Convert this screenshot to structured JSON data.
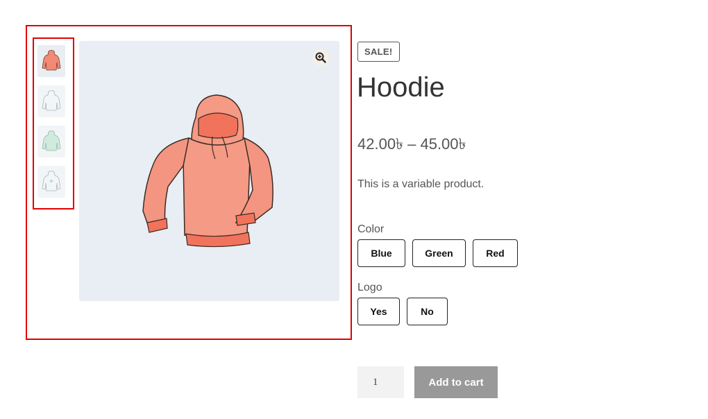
{
  "gallery": {
    "thumbnails": [
      {
        "name": "hoodie-pink",
        "color": "#f08a74"
      },
      {
        "name": "hoodie-white",
        "color": "#d7e6e8"
      },
      {
        "name": "hoodie-green",
        "color": "#a8dcc4"
      },
      {
        "name": "hoodie-white-logo",
        "color": "#d7e6e8"
      }
    ],
    "main_image_color": "#f0907a",
    "zoom_icon": "zoom-in-icon"
  },
  "product": {
    "badge": "SALE!",
    "title": "Hoodie",
    "price": "42.00৳ – 45.00৳",
    "description": "This is a variable product."
  },
  "attributes": {
    "color_label": "Color",
    "color_options": [
      "Blue",
      "Green",
      "Red"
    ],
    "logo_label": "Logo",
    "logo_options": [
      "Yes",
      "No"
    ]
  },
  "cart": {
    "quantity": "1",
    "button_label": "Add to cart"
  },
  "colors": {
    "highlight_border": "#e00000",
    "button_bg": "#999999"
  }
}
